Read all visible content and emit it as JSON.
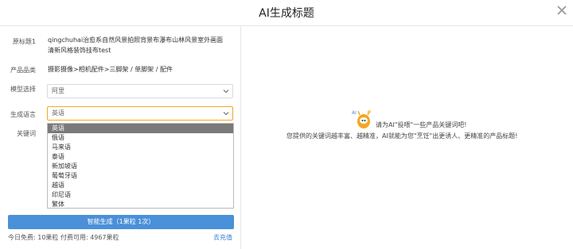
{
  "dialog": {
    "title": "AI生成标题"
  },
  "form": {
    "original_title": {
      "label": "原标题1",
      "value_line1": "qingchuhai治愈系自然风景拍照背景布瀑布山林风景室外画面",
      "value_line2": "清新风格装饰挂布test"
    },
    "category": {
      "label": "产品品类",
      "value": "摄影摄像>相机配件>三脚架 / 单脚架 / 配件"
    },
    "model": {
      "label": "模型选择",
      "value": "阿里"
    },
    "language": {
      "label": "生成语言",
      "value": "英语",
      "options": [
        "英语",
        "俄语",
        "马来语",
        "泰语",
        "新加坡语",
        "葡萄牙语",
        "越语",
        "印尼语",
        "繁体"
      ],
      "selected_index": 0
    },
    "keywords": {
      "label": "关键词"
    }
  },
  "generate_button": "智能生成（1果粒 1次）",
  "footer": {
    "quota": "今日免费: 10果粒 付费可用: 4967果粒",
    "recharge": "去充值"
  },
  "tips": {
    "line1": "请为AI\"投喂\"一些产品关键词吧!",
    "line2": "您提供的关键词越丰富、越精准，AI就能为您\"烹饪\"出更诱人、更精准的产品标题!"
  },
  "colors": {
    "primary": "#4a90d9",
    "focus_border": "#f5a623",
    "selected_option_bg": "#7a7a7a",
    "mascot": "#f5a623"
  },
  "icons": {
    "close": "close-icon",
    "dropdown": "chevron-down-icon",
    "mascot": "ai-mascot-icon"
  }
}
